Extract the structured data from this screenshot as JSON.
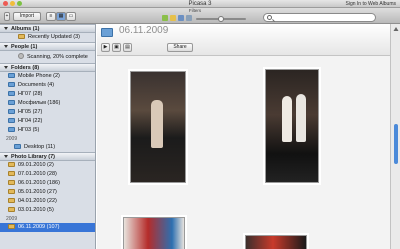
{
  "window": {
    "title": "Picasa 3",
    "sign_in": "Sign In to Web Albums",
    "traffic_lights": {
      "close": "#ee5b54",
      "minimize": "#f1bd3b",
      "zoom": "#7cc142"
    }
  },
  "toolbar": {
    "import_label": "Import",
    "filters_label": "Filters",
    "search_placeholder": ""
  },
  "sidebar": {
    "albums": {
      "label": "Albums (1)",
      "items": [
        {
          "label": "Recently Updated (3)"
        }
      ]
    },
    "people": {
      "label": "People (1)",
      "items": [
        {
          "label": "Scanning, 20% complete"
        }
      ]
    },
    "folders": {
      "label": "Folders (8)",
      "items": [
        {
          "label": "Mobile Phone (2)"
        },
        {
          "label": "Documents (4)"
        },
        {
          "label": "НГ07 (28)"
        },
        {
          "label": "Мосфильм (186)"
        },
        {
          "label": "НГ05 (27)"
        },
        {
          "label": "НГ04 (22)"
        },
        {
          "label": "НГ03 (5)"
        }
      ],
      "year_2009": "2009",
      "desktop": "Desktop (11)"
    },
    "photo_library": {
      "label": "Photo Library (7)",
      "items": [
        {
          "label": "09.01.2010 (2)"
        },
        {
          "label": "07.01.2010 (28)"
        },
        {
          "label": "06.01.2010 (186)"
        },
        {
          "label": "05.01.2010 (27)"
        },
        {
          "label": "04.01.2010 (22)"
        },
        {
          "label": "03.01.2010 (5)"
        }
      ],
      "year_2009": "2009",
      "selected": "06.11.2009 (107)"
    }
  },
  "main": {
    "folder_title": "06.11.2009",
    "folder_sub": "",
    "share_label": "Share",
    "photos": [
      {
        "name": "photo-1",
        "colors": [
          "#5a4a3e",
          "#1b1b1b",
          "#c9b8a4"
        ]
      },
      {
        "name": "photo-2",
        "colors": [
          "#4a3b33",
          "#111111",
          "#e9e6e1"
        ]
      },
      {
        "name": "photo-3",
        "colors": [
          "#e8e3dd",
          "#b52c2a",
          "#2d6fb0"
        ]
      },
      {
        "name": "photo-4",
        "colors": [
          "#3c2f2c",
          "#c83a2b",
          "#1b1b1b"
        ]
      }
    ]
  }
}
